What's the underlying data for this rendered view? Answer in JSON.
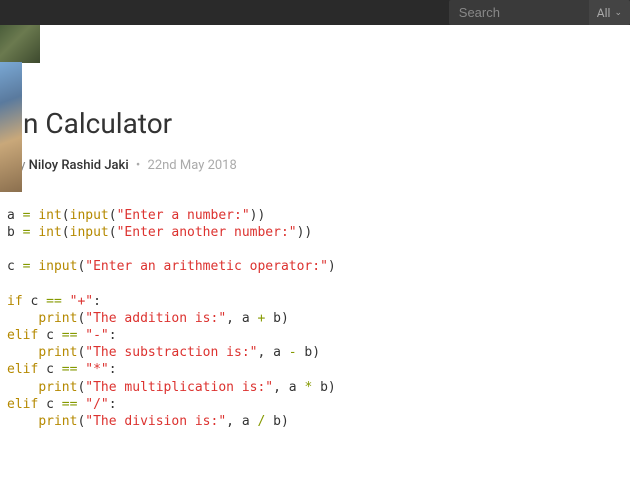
{
  "search": {
    "placeholder": "Search",
    "filter_label": "All"
  },
  "post": {
    "title_fragment": "n Calculator",
    "by_label": "by",
    "author": "Niloy Rashid Jaki",
    "date": "22nd May 2018"
  },
  "code": {
    "l1": {
      "v": "a ",
      "eq": "=",
      "s": " ",
      "int": "int",
      "p1": "(",
      "input": "input",
      "p2": "(",
      "str": "\"Enter a number:\"",
      "p3": "))"
    },
    "l2": {
      "v": "b ",
      "eq": "=",
      "s": " ",
      "int": "int",
      "p1": "(",
      "input": "input",
      "p2": "(",
      "str": "\"Enter another number:\"",
      "p3": "))"
    },
    "l3": {
      "v": "c ",
      "eq": "=",
      "s": " ",
      "input": "input",
      "p1": "(",
      "str": "\"Enter an arithmetic operator:\"",
      "p2": ")"
    },
    "b1": {
      "kw": "if",
      "v": " c ",
      "eq": "==",
      "s": " ",
      "str": "\"+\"",
      "colon": ":"
    },
    "p1": {
      "indent": "    ",
      "print": "print",
      "po": "(",
      "str": "\"The addition is:\"",
      "c": ", a ",
      "op": "+",
      "r": " b)"
    },
    "b2": {
      "kw": "elif",
      "v": " c ",
      "eq": "==",
      "s": " ",
      "str": "\"-\"",
      "colon": ":"
    },
    "p2": {
      "indent": "    ",
      "print": "print",
      "po": "(",
      "str": "\"The substraction is:\"",
      "c": ", a ",
      "op": "-",
      "r": " b)"
    },
    "b3": {
      "kw": "elif",
      "v": " c ",
      "eq": "==",
      "s": " ",
      "str": "\"*\"",
      "colon": ":"
    },
    "p3": {
      "indent": "    ",
      "print": "print",
      "po": "(",
      "str": "\"The multiplication is:\"",
      "c": ", a ",
      "op": "*",
      "r": " b)"
    },
    "b4": {
      "kw": "elif",
      "v": " c ",
      "eq": "==",
      "s": " ",
      "str": "\"/\"",
      "colon": ":"
    },
    "p4": {
      "indent": "    ",
      "print": "print",
      "po": "(",
      "str": "\"The division is:\"",
      "c": ", a ",
      "op": "/",
      "r": " b)"
    }
  }
}
